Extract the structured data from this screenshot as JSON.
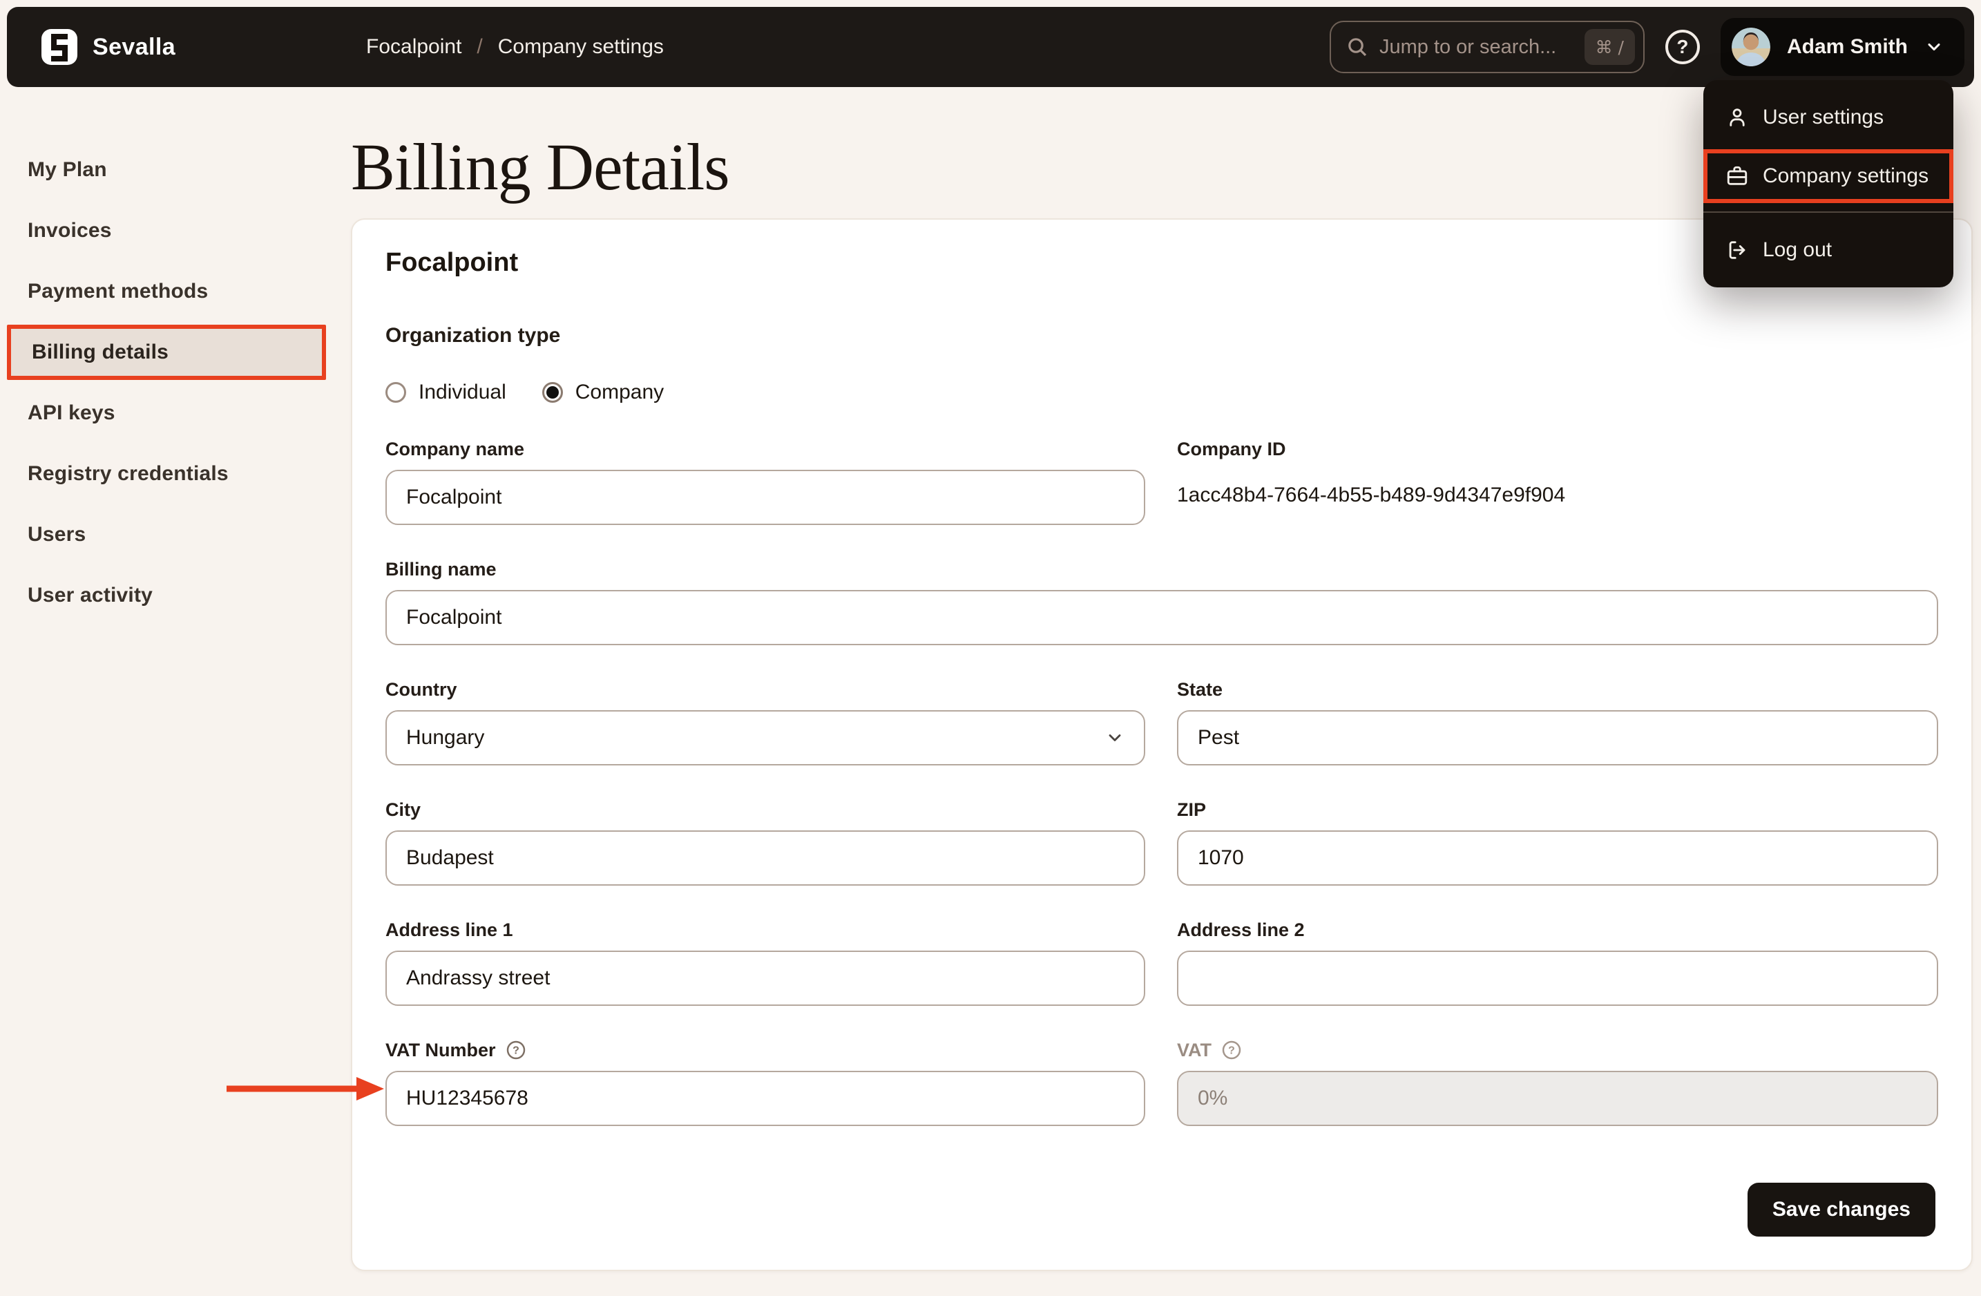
{
  "brand": {
    "name": "Sevalla"
  },
  "breadcrumb": {
    "parent": "Focalpoint",
    "separator": "/",
    "current": "Company settings"
  },
  "topbar": {
    "search_placeholder": "Jump to or search...",
    "search_shortcut": "⌘ /",
    "user_name": "Adam Smith"
  },
  "user_menu": {
    "items": [
      {
        "label": "User settings"
      },
      {
        "label": "Company settings",
        "highlighted": true
      },
      {
        "label": "Log out"
      }
    ]
  },
  "sidebar": {
    "items": [
      {
        "label": "My Plan"
      },
      {
        "label": "Invoices"
      },
      {
        "label": "Payment methods"
      },
      {
        "label": "Billing details",
        "active": true
      },
      {
        "label": "API keys"
      },
      {
        "label": "Registry credentials"
      },
      {
        "label": "Users"
      },
      {
        "label": "User activity"
      }
    ]
  },
  "page": {
    "title": "Billing Details"
  },
  "form": {
    "company_heading": "Focalpoint",
    "organization_type": {
      "label": "Organization type",
      "options": [
        {
          "label": "Individual",
          "selected": false
        },
        {
          "label": "Company",
          "selected": true
        }
      ]
    },
    "fields": {
      "company_name": {
        "label": "Company name",
        "value": "Focalpoint"
      },
      "company_id": {
        "label": "Company ID",
        "value": "1acc48b4-7664-4b55-b489-9d4347e9f904"
      },
      "billing_name": {
        "label": "Billing name",
        "value": "Focalpoint"
      },
      "country": {
        "label": "Country",
        "value": "Hungary"
      },
      "state": {
        "label": "State",
        "value": "Pest"
      },
      "city": {
        "label": "City",
        "value": "Budapest"
      },
      "zip": {
        "label": "ZIP",
        "value": "1070"
      },
      "address1": {
        "label": "Address line 1",
        "value": "Andrassy street"
      },
      "address2": {
        "label": "Address line 2",
        "value": ""
      },
      "vat_number": {
        "label": "VAT Number",
        "value": "HU12345678"
      },
      "vat": {
        "label": "VAT",
        "value": "0%",
        "disabled": true
      }
    },
    "save_label": "Save changes"
  },
  "colors": {
    "annotation_red": "#e8401f",
    "navbar_bg": "#1d1916",
    "page_bg": "#f8f3ee",
    "active_item_bg": "#e8dfd7"
  }
}
